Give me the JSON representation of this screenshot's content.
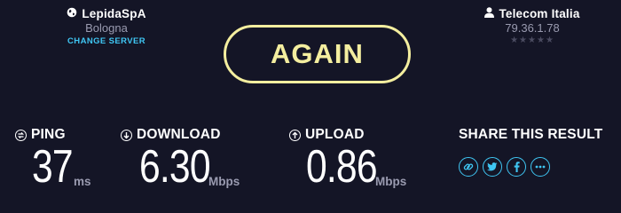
{
  "server": {
    "name": "LepidaSpA",
    "location": "Bologna",
    "change_label": "CHANGE SERVER"
  },
  "isp": {
    "name": "Telecom Italia",
    "ip": "79.36.1.78",
    "rating_stars": "★★★★★",
    "rating_value": 0,
    "rating_max": 5
  },
  "again_button": {
    "label": "AGAIN"
  },
  "metrics": {
    "ping": {
      "label": "PING",
      "value": "37",
      "unit": "ms",
      "icon": "ping-icon"
    },
    "download": {
      "label": "DOWNLOAD",
      "value": "6.30",
      "unit": "Mbps",
      "icon": "download-arrow-icon"
    },
    "upload": {
      "label": "UPLOAD",
      "value": "0.86",
      "unit": "Mbps",
      "icon": "upload-arrow-icon"
    }
  },
  "share": {
    "title": "SHARE THIS RESULT",
    "icons": [
      "link-icon",
      "twitter-icon",
      "facebook-icon",
      "more-icon"
    ]
  },
  "colors": {
    "background": "#141526",
    "accent_yellow": "#f4ee9f",
    "accent_blue": "#3fc6f3",
    "muted_text": "#9a9bb0"
  }
}
